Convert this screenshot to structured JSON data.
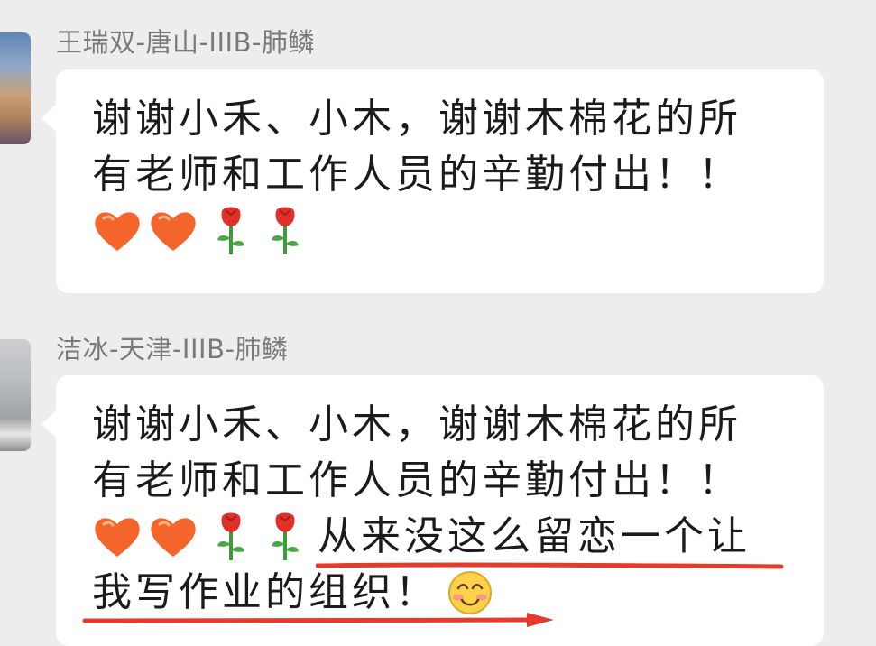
{
  "messages": [
    {
      "sender": "王瑞双-唐山-IIIB-肺鳞",
      "lines": [
        "谢谢小禾、小木，谢谢木棉花的所",
        "有老师和工作人员的辛勤付出！！"
      ],
      "emojis": [
        "heart-emoji",
        "heart-emoji",
        "rose-emoji",
        "rose-emoji"
      ]
    },
    {
      "sender": "洁冰-天津-IIIB-肺鳞",
      "lines": [
        "谢谢小禾、小木，谢谢木棉花的所",
        "有老师和工作人员的辛勤付出！！"
      ],
      "emojis": [
        "heart-emoji",
        "heart-emoji",
        "rose-emoji",
        "rose-emoji"
      ],
      "emoji_line_tail": "从来没这么留恋一个让",
      "last_line": "我写作业的组织！",
      "last_emoji": "smile-emoji"
    }
  ],
  "colors": {
    "background": "#ededed",
    "bubble": "#ffffff",
    "sender_text": "#7a7a7a",
    "message_text": "#1b1b1b",
    "underline": "#e8392c",
    "heart": "#f4652b"
  }
}
